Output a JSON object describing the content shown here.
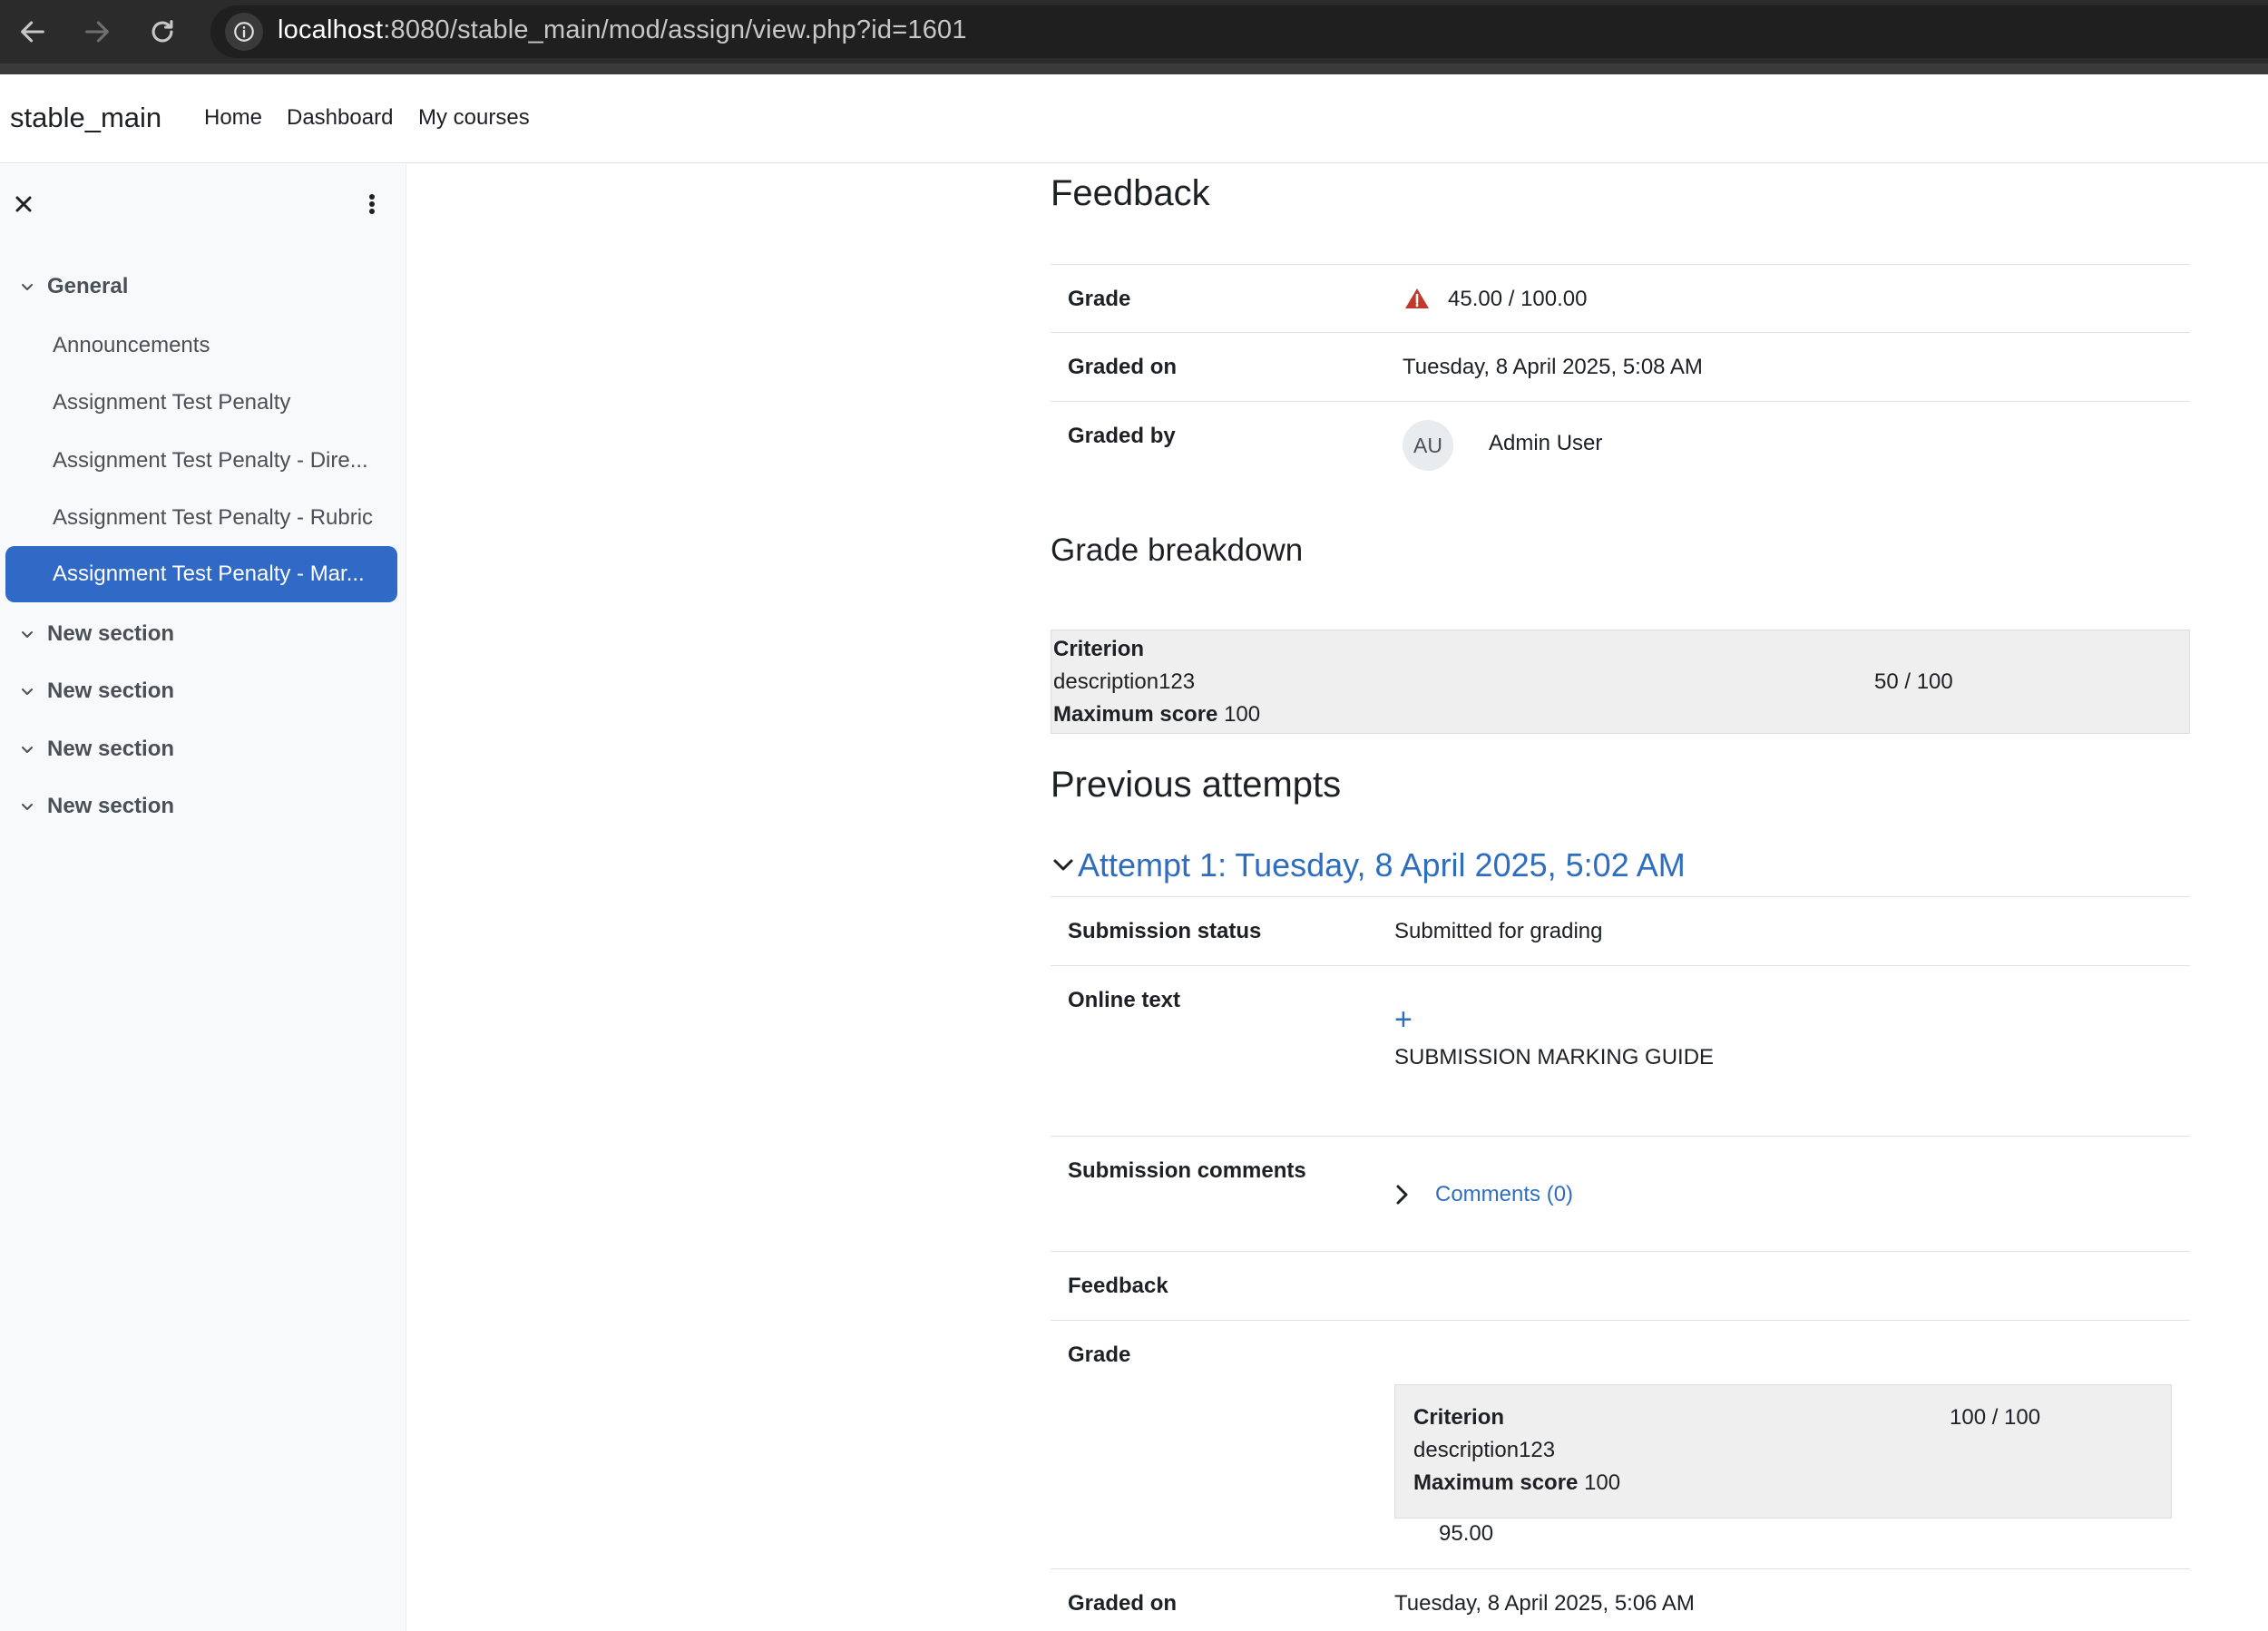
{
  "browser": {
    "url_host": "localhost",
    "url_path": ":8080/stable_main/mod/assign/view.php?id=1601"
  },
  "site": {
    "brand": "stable_main",
    "nav": [
      "Home",
      "Dashboard",
      "My courses"
    ]
  },
  "drawer": {
    "sections": [
      {
        "label": "General"
      },
      {
        "label": "New section"
      },
      {
        "label": "New section"
      },
      {
        "label": "New section"
      },
      {
        "label": "New section"
      }
    ],
    "activities": [
      {
        "label": "Announcements"
      },
      {
        "label": "Assignment Test Penalty"
      },
      {
        "label": "Assignment Test Penalty - Dire..."
      },
      {
        "label": "Assignment Test Penalty - Rubric"
      },
      {
        "label": "Assignment Test Penalty - Mar..."
      }
    ]
  },
  "feedback": {
    "title": "Feedback",
    "grade_label": "Grade",
    "grade_value": "45.00 / 100.00",
    "graded_on_label": "Graded on",
    "graded_on_value": "Tuesday, 8 April 2025, 5:08 AM",
    "graded_by_label": "Graded by",
    "avatar_initials": "AU",
    "graded_by_value": "Admin User"
  },
  "breakdown": {
    "title": "Grade breakdown",
    "criterion_label": "Criterion",
    "description": "description123",
    "score": "50 / 100",
    "max_label": "Maximum score",
    "max_value": "100"
  },
  "previous": {
    "title": "Previous attempts",
    "attempt_title": "Attempt 1: Tuesday, 8 April 2025, 5:02 AM",
    "submission_status_label": "Submission status",
    "submission_status_value": "Submitted for grading",
    "online_text_label": "Online text",
    "online_text_plus": "+",
    "online_text_value": "SUBMISSION MARKING GUIDE",
    "comments_label": "Submission comments",
    "comments_link": "Comments (0)",
    "feedback_label": "Feedback",
    "grade_label": "Grade",
    "criterion_label": "Criterion",
    "description": "description123",
    "score": "100 / 100",
    "max_label": "Maximum score",
    "max_value": "100",
    "grade_value": "95.00",
    "graded_on_label": "Graded on",
    "graded_on_value": "Tuesday, 8 April 2025, 5:06 AM"
  },
  "colors": {
    "accent": "#3169c6",
    "link": "#2f6dbf",
    "warning": "#c0392b"
  }
}
